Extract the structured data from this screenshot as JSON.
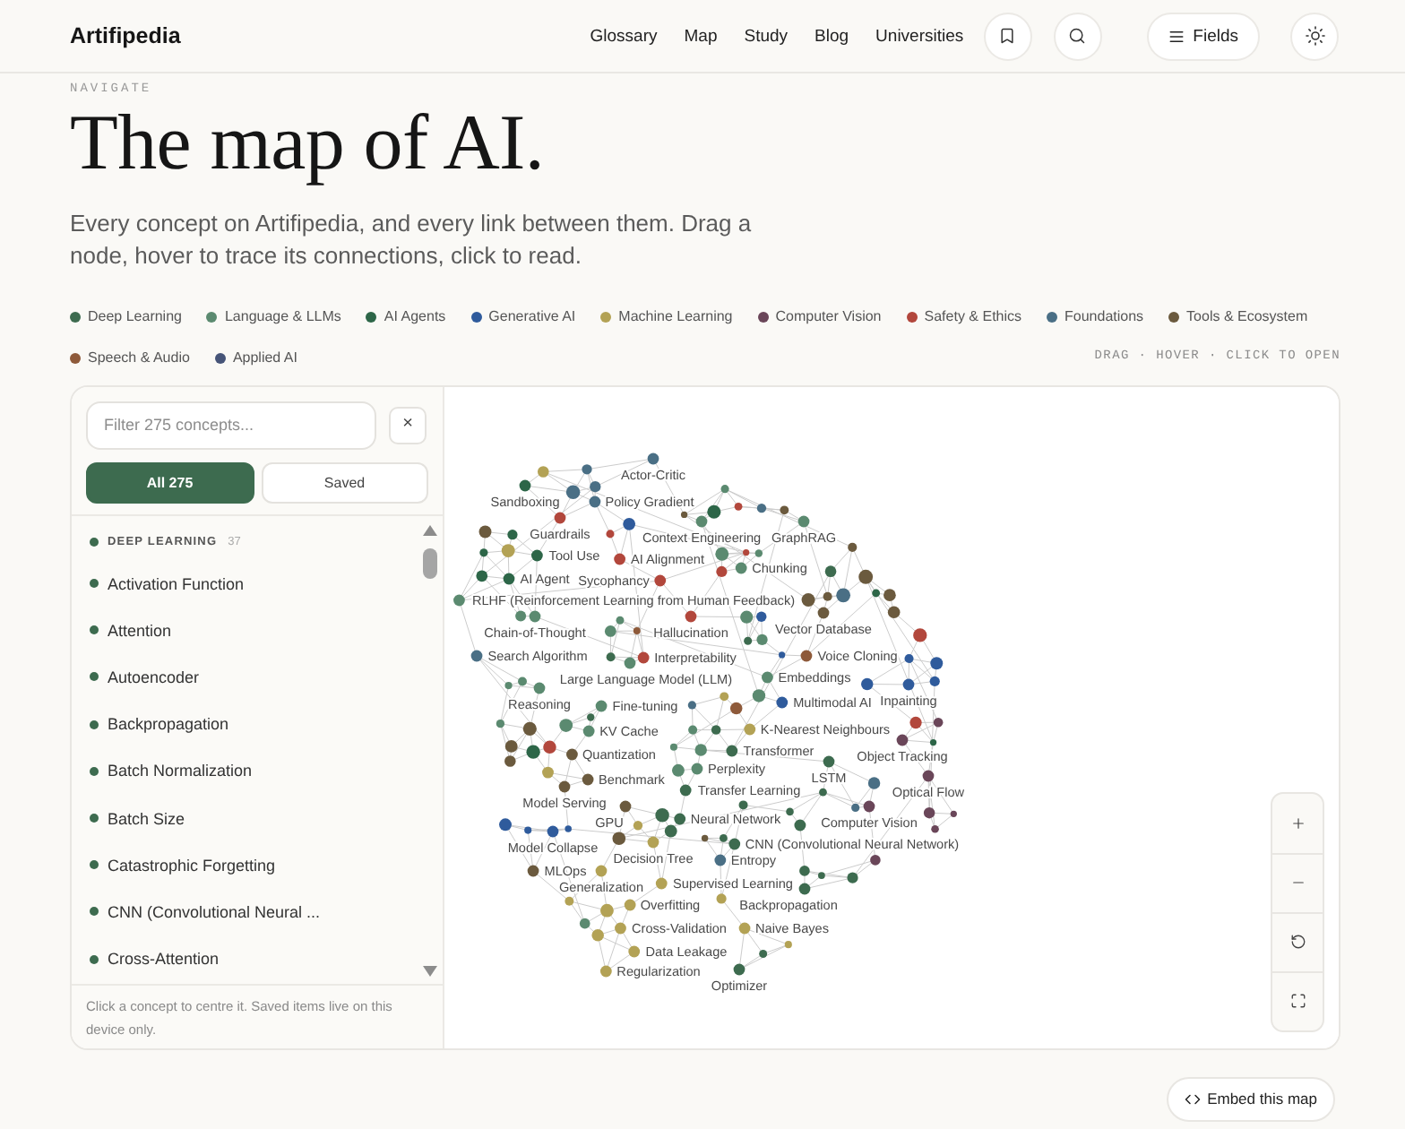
{
  "header": {
    "logo": "Artifipedia",
    "nav": [
      "Glossary",
      "Map",
      "Study",
      "Blog",
      "Universities"
    ],
    "fields_button": "Fields"
  },
  "intro": {
    "eyebrow": "NAVIGATE",
    "title": "The map of AI.",
    "description": "Every concept on Artifipedia, and every link between them. Drag a node, hover to trace its connections, click to read."
  },
  "legend": [
    {
      "label": "Deep Learning",
      "color": "#3d6b4f"
    },
    {
      "label": "Language & LLMs",
      "color": "#5b8a70"
    },
    {
      "label": "AI Agents",
      "color": "#2d6648"
    },
    {
      "label": "Generative AI",
      "color": "#2f5b9c"
    },
    {
      "label": "Machine Learning",
      "color": "#b3a255"
    },
    {
      "label": "Computer Vision",
      "color": "#6a4659"
    },
    {
      "label": "Safety & Ethics",
      "color": "#b2473c"
    },
    {
      "label": "Foundations",
      "color": "#4a6f85"
    },
    {
      "label": "Tools & Ecosystem",
      "color": "#6b5a3e"
    },
    {
      "label": "Speech & Audio",
      "color": "#8e5a3a"
    },
    {
      "label": "Applied AI",
      "color": "#465478"
    }
  ],
  "hint": "DRAG · HOVER · CLICK TO OPEN",
  "sidebar": {
    "filter": {
      "placeholder": "Filter 275 concepts..."
    },
    "clear_button": "×",
    "tabs": [
      {
        "label": "All 275",
        "selected": true
      },
      {
        "label": "Saved",
        "selected": false
      }
    ],
    "groups": [
      {
        "title": "DEEP LEARNING",
        "count": "37",
        "color": "#3d6b4f",
        "items": [
          "Activation Function",
          "Attention",
          "Autoencoder",
          "Backpropagation",
          "Batch Normalization",
          "Batch Size",
          "Catastrophic Forgetting",
          "CNN (Convolutional Neural ...",
          "Cross-Attention"
        ]
      }
    ],
    "footer": "Click a concept to centre it. Saved items live on this device only."
  },
  "graph": {
    "nodes": [
      {
        "label": "Actor-Critic",
        "color": "#4a6f85"
      },
      {
        "label": "Sandboxing",
        "color": "#2d6648"
      },
      {
        "label": "Policy Gradient",
        "color": "#4a6f85"
      },
      {
        "label": "Guardrails",
        "color": "#b2473c"
      },
      {
        "label": "Context Engineering",
        "color": "#5b8a70"
      },
      {
        "label": "GraphRAG",
        "color": "#5b8a70"
      },
      {
        "label": "Tool Use",
        "color": "#2d6648"
      },
      {
        "label": "AI Alignment",
        "color": "#b2473c"
      },
      {
        "label": "Chunking",
        "color": "#5b8a70"
      },
      {
        "label": "AI Agent",
        "color": "#2d6648"
      },
      {
        "label": "Sycophancy",
        "color": "#b2473c"
      },
      {
        "label": "RLHF (Reinforcement Learning from Human Feedback)",
        "color": "#5b8a70"
      },
      {
        "label": "Chain-of-Thought",
        "color": "#5b8a70"
      },
      {
        "label": "Hallucination",
        "color": "#b2473c"
      },
      {
        "label": "Vector Database",
        "color": "#6b5a3e"
      },
      {
        "label": "Search Algorithm",
        "color": "#4a6f85"
      },
      {
        "label": "Interpretability",
        "color": "#b2473c"
      },
      {
        "label": "Voice Cloning",
        "color": "#8e5a3a"
      },
      {
        "label": "Large Language Model (LLM)",
        "color": "#5b8a70"
      },
      {
        "label": "Embeddings",
        "color": "#5b8a70"
      },
      {
        "label": "Reasoning",
        "color": "#5b8a70"
      },
      {
        "label": "Fine-tuning",
        "color": "#5b8a70"
      },
      {
        "label": "Multimodal AI",
        "color": "#2f5b9c"
      },
      {
        "label": "Inpainting",
        "color": "#2f5b9c"
      },
      {
        "label": "KV Cache",
        "color": "#5b8a70"
      },
      {
        "label": "K-Nearest Neighbours",
        "color": "#b3a255"
      },
      {
        "label": "Quantization",
        "color": "#6b5a3e"
      },
      {
        "label": "Transformer",
        "color": "#3d6b4f"
      },
      {
        "label": "Object Tracking",
        "color": "#6a4659"
      },
      {
        "label": "Perplexity",
        "color": "#5b8a70"
      },
      {
        "label": "Benchmark",
        "color": "#6b5a3e"
      },
      {
        "label": "LSTM",
        "color": "#3d6b4f"
      },
      {
        "label": "Transfer Learning",
        "color": "#3d6b4f"
      },
      {
        "label": "Optical Flow",
        "color": "#6a4659"
      },
      {
        "label": "Model Serving",
        "color": "#6b5a3e"
      },
      {
        "label": "GPU",
        "color": "#6b5a3e"
      },
      {
        "label": "Neural Network",
        "color": "#3d6b4f"
      },
      {
        "label": "Computer Vision",
        "color": "#6a4659"
      },
      {
        "label": "Model Collapse",
        "color": "#2f5b9c"
      },
      {
        "label": "CNN (Convolutional Neural Network)",
        "color": "#3d6b4f"
      },
      {
        "label": "Decision Tree",
        "color": "#b3a255"
      },
      {
        "label": "Entropy",
        "color": "#4a6f85"
      },
      {
        "label": "MLOps",
        "color": "#6b5a3e"
      },
      {
        "label": "Generalization",
        "color": "#b3a255"
      },
      {
        "label": "Supervised Learning",
        "color": "#b3a255"
      },
      {
        "label": "Overfitting",
        "color": "#b3a255"
      },
      {
        "label": "Backpropagation",
        "color": "#3d6b4f"
      },
      {
        "label": "Cross-Validation",
        "color": "#b3a255"
      },
      {
        "label": "Naive Bayes",
        "color": "#b3a255"
      },
      {
        "label": "Data Leakage",
        "color": "#b3a255"
      },
      {
        "label": "Regularization",
        "color": "#b3a255"
      },
      {
        "label": "Optimizer",
        "color": "#3d6b4f"
      }
    ]
  },
  "embed_button": "Embed this map"
}
